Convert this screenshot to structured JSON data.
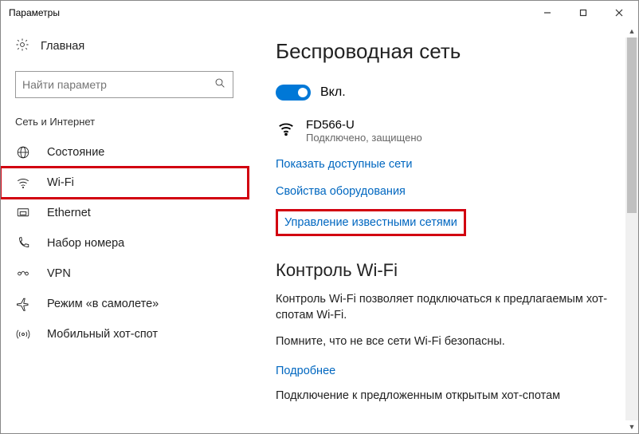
{
  "titlebar": {
    "title": "Параметры"
  },
  "sidebar": {
    "home_label": "Главная",
    "search_placeholder": "Найти параметр",
    "group_label": "Сеть и Интернет",
    "items": [
      {
        "label": "Состояние"
      },
      {
        "label": "Wi-Fi"
      },
      {
        "label": "Ethernet"
      },
      {
        "label": "Набор номера"
      },
      {
        "label": "VPN"
      },
      {
        "label": "Режим «в самолете»"
      },
      {
        "label": "Мобильный хот-спот"
      }
    ]
  },
  "main": {
    "heading": "Беспроводная сеть",
    "toggle_label": "Вкл.",
    "network": {
      "name": "FD566-U",
      "status": "Подключено, защищено"
    },
    "links": {
      "available": "Показать доступные сети",
      "properties": "Свойства оборудования",
      "manage": "Управление известными сетями"
    },
    "wifi_control": {
      "heading": "Контроль Wi-Fi",
      "p1": "Контроль Wi-Fi позволяет подключаться к предлагаемым хот-спотам Wi-Fi.",
      "p2": "Помните, что не все сети Wi-Fi безопасны.",
      "more": "Подробнее",
      "p3": "Подключение к предложенным открытым хот-спотам"
    }
  }
}
